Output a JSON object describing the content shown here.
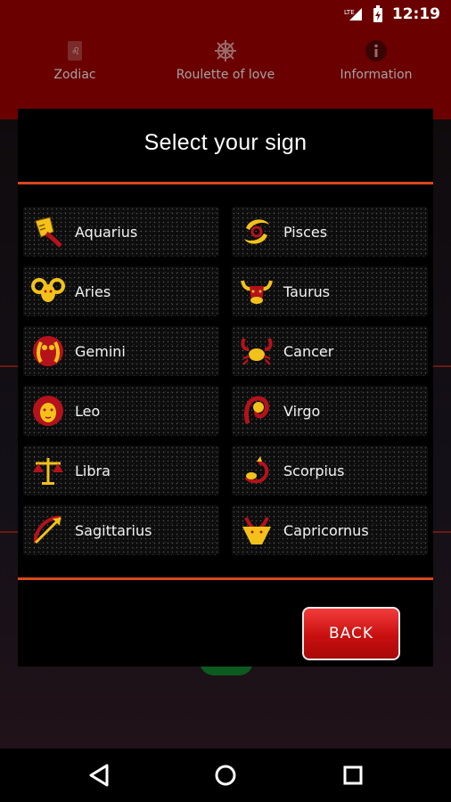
{
  "status_bar": {
    "network": "LTE",
    "time": "12:19"
  },
  "tabs": [
    {
      "label": "Zodiac",
      "icon": "zodiac-card-icon"
    },
    {
      "label": "Roulette of love",
      "icon": "ship-wheel-icon"
    },
    {
      "label": "Information",
      "icon": "info-icon"
    }
  ],
  "dialog": {
    "title": "Select your sign",
    "signs": [
      {
        "label": "Aquarius",
        "icon": "aquarius-icon"
      },
      {
        "label": "Pisces",
        "icon": "pisces-icon"
      },
      {
        "label": "Aries",
        "icon": "aries-icon"
      },
      {
        "label": "Taurus",
        "icon": "taurus-icon"
      },
      {
        "label": "Gemini",
        "icon": "gemini-icon"
      },
      {
        "label": "Cancer",
        "icon": "cancer-icon"
      },
      {
        "label": "Leo",
        "icon": "leo-icon"
      },
      {
        "label": "Virgo",
        "icon": "virgo-icon"
      },
      {
        "label": "Libra",
        "icon": "libra-icon"
      },
      {
        "label": "Scorpius",
        "icon": "scorpius-icon"
      },
      {
        "label": "Sagittarius",
        "icon": "sagittarius-icon"
      },
      {
        "label": "Capricornus",
        "icon": "capricornus-icon"
      }
    ],
    "back_label": "BACK"
  },
  "colors": {
    "accent_line": "#d8471f",
    "header": "#6a0000",
    "button": "#d01818",
    "icon_gold": "#f3c21a",
    "icon_red": "#b5121b"
  }
}
